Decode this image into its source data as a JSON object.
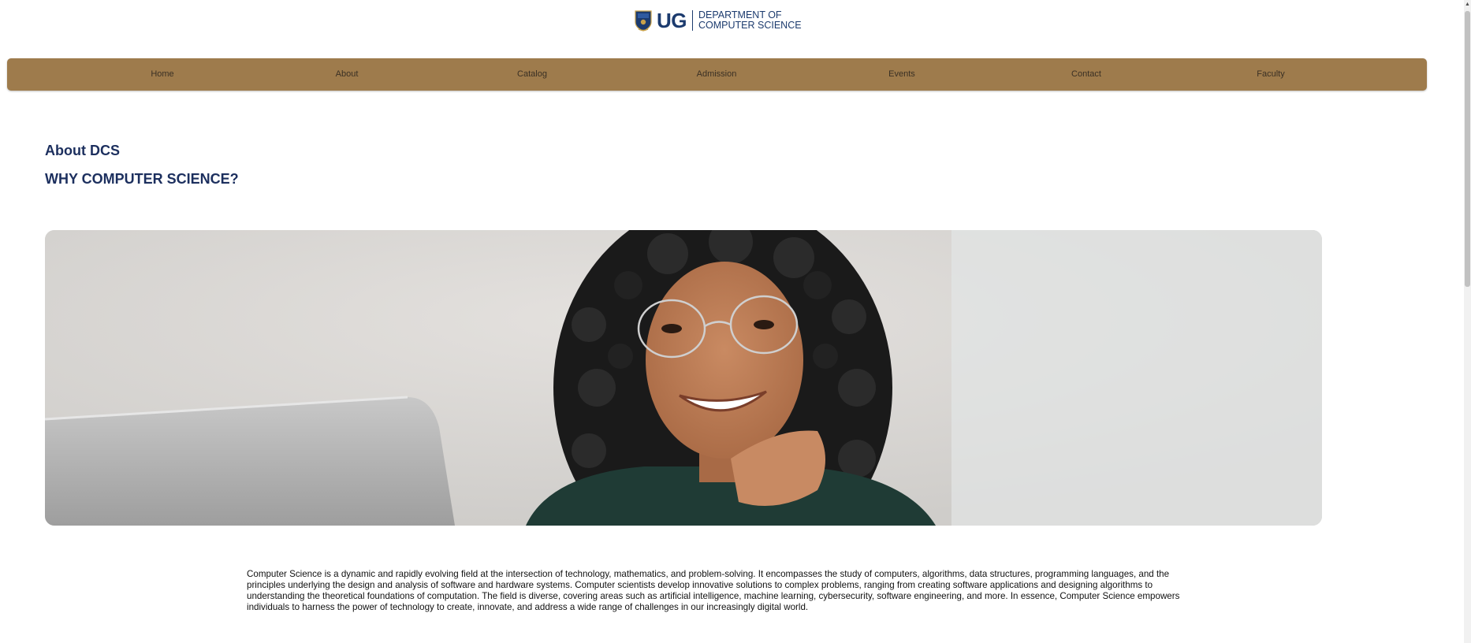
{
  "header": {
    "logo_short": "UG",
    "logo_line1": "DEPARTMENT OF",
    "logo_line2": "COMPUTER SCIENCE",
    "brand_color": "#1c3b6e"
  },
  "nav": {
    "background_color": "#9e7b4c",
    "items": [
      {
        "label": "Home"
      },
      {
        "label": "About"
      },
      {
        "label": "Catalog"
      },
      {
        "label": "Admission"
      },
      {
        "label": "Events"
      },
      {
        "label": "Contact"
      },
      {
        "label": "Faculty"
      }
    ]
  },
  "main": {
    "title": "About DCS",
    "subtitle": "WHY COMPUTER SCIENCE?",
    "hero_image_icon": "student-smiling-photo",
    "description": "Computer Science is a dynamic and rapidly evolving field at the intersection of technology, mathematics, and problem-solving. It encompasses the study of computers, algorithms, data structures, programming languages, and the principles underlying the design and analysis of software and hardware systems. Computer scientists develop innovative solutions to complex problems, ranging from creating software applications and designing algorithms to understanding the theoretical foundations of computation. The field is diverse, covering areas such as artificial intelligence, machine learning, cybersecurity, software engineering, and more. In essence, Computer Science empowers individuals to harness the power of technology to create, innovate, and address a wide range of challenges in our increasingly digital world."
  }
}
